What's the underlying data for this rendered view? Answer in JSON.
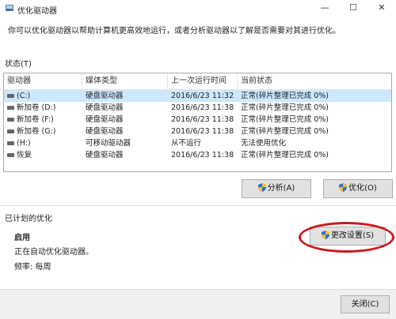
{
  "window": {
    "title": "优化驱动器",
    "minimize": "—",
    "maximize": "☐",
    "close": "✕"
  },
  "description": "你可以优化驱动器以帮助计算机更高效地运行，或者分析驱动器以了解是否需要对其进行优化。",
  "status_label": "状态(T)",
  "columns": [
    "驱动器",
    "媒体类型",
    "上一次运行时间",
    "当前状态"
  ],
  "drives": [
    {
      "name": "(C:)",
      "media": "硬盘驱动器",
      "last_run": "2016/6/23 11:32",
      "status": "正常(碎片整理已完成 0%)",
      "selected": true
    },
    {
      "name": "新加卷 (D:)",
      "media": "硬盘驱动器",
      "last_run": "2016/6/23 11:38",
      "status": "正常(碎片整理已完成 0%)",
      "selected": false
    },
    {
      "name": "新加卷 (F:)",
      "media": "硬盘驱动器",
      "last_run": "2016/6/23 11:38",
      "status": "正常(碎片整理已完成 0%)",
      "selected": false
    },
    {
      "name": "新加卷 (G:)",
      "media": "硬盘驱动器",
      "last_run": "2016/6/23 11:38",
      "status": "正常(碎片整理已完成 0%)",
      "selected": false
    },
    {
      "name": "(H:)",
      "media": "可移动驱动器",
      "last_run": "从不运行",
      "status": "无法使用优化",
      "selected": false
    },
    {
      "name": "恢复",
      "media": "硬盘驱动器",
      "last_run": "2016/6/23 11:38",
      "status": "正常(碎片整理已完成 0%)",
      "selected": false
    }
  ],
  "buttons": {
    "analyze": "分析(A)",
    "optimize": "优化(O)",
    "change_settings": "更改设置(S)",
    "close": "关闭(C)"
  },
  "scheduled": {
    "label": "已计划的优化",
    "state": "启用",
    "running": "正在自动优化驱动器。",
    "frequency": "频率: 每周"
  },
  "colors": {
    "selection": "#cce8ff",
    "highlight_circle": "#c9191e",
    "shield_blue": "#2a6fd6",
    "shield_yellow": "#f2c230"
  }
}
